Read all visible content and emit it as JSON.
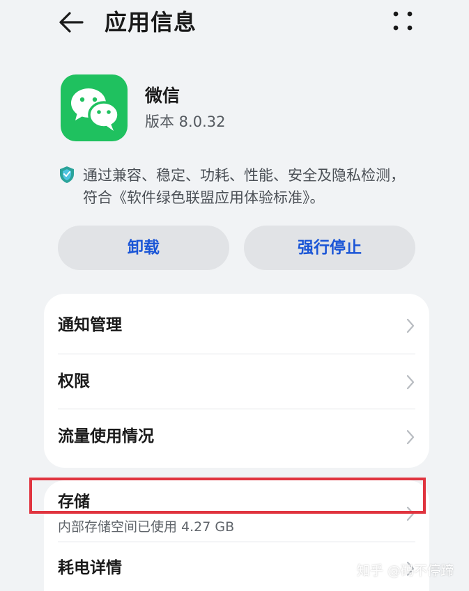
{
  "header": {
    "title": "应用信息",
    "back_icon": "arrow-left-icon",
    "more_icon": "more-dots-icon"
  },
  "app": {
    "name": "微信",
    "version": "版本 8.0.32",
    "icon": "wechat-app-icon",
    "icon_color": "#1fc15f"
  },
  "certification": {
    "icon": "shield-icon",
    "text": "通过兼容、稳定、功耗、性能、安全及隐私检测，符合《软件绿色联盟应用体验标准》。"
  },
  "actions": {
    "uninstall_label": "卸载",
    "force_stop_label": "强行停止",
    "label_color": "#1a55d6"
  },
  "settings_group_1": {
    "items": [
      {
        "label": "通知管理"
      },
      {
        "label": "权限"
      },
      {
        "label": "流量使用情况"
      }
    ]
  },
  "settings_group_2": {
    "items": [
      {
        "label": "存储",
        "sublabel": "内部存储空间已使用 4.27 GB"
      },
      {
        "label": "耗电详情"
      }
    ]
  },
  "highlight_color": "#e0343f",
  "watermark": "知乎 @码不停蹄"
}
